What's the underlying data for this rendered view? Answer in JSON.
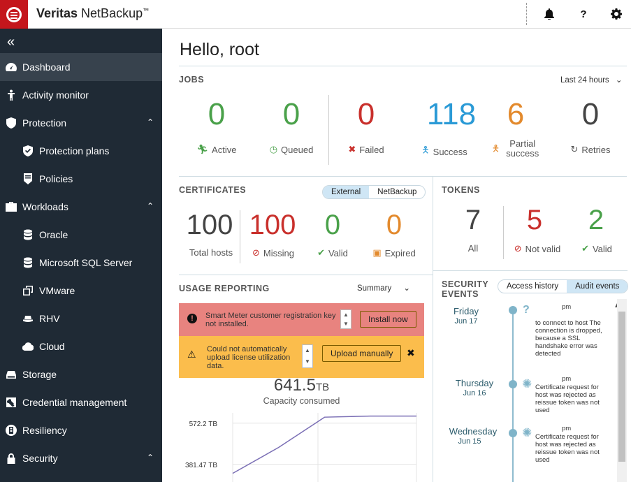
{
  "header": {
    "brand_bold": "Veritas",
    "brand_light": " NetBackup",
    "brand_tm": "™",
    "icons": [
      "bell-icon",
      "help-icon",
      "gear-icon"
    ],
    "help_label": "?",
    "brand_color": "#c4161c"
  },
  "sidebar": {
    "collapse_label": "«",
    "items": [
      {
        "label": "Dashboard",
        "icon": "gauge-icon",
        "active": true
      },
      {
        "label": "Activity monitor",
        "icon": "person-icon"
      },
      {
        "label": "Protection",
        "icon": "shield-icon",
        "expanded": true
      },
      {
        "label": "Protection plans",
        "icon": "shield-check-icon",
        "sub": true
      },
      {
        "label": "Policies",
        "icon": "policy-icon",
        "sub": true
      },
      {
        "label": "Workloads",
        "icon": "briefcase-icon",
        "expanded": true
      },
      {
        "label": "Oracle",
        "icon": "database-icon",
        "sub": true
      },
      {
        "label": "Microsoft SQL Server",
        "icon": "database-icon",
        "sub": true
      },
      {
        "label": "VMware",
        "icon": "vm-icon",
        "sub": true
      },
      {
        "label": "RHV",
        "icon": "hat-icon",
        "sub": true
      },
      {
        "label": "Cloud",
        "icon": "cloud-icon",
        "sub": true
      },
      {
        "label": "Storage",
        "icon": "storage-icon"
      },
      {
        "label": "Credential management",
        "icon": "key-icon"
      },
      {
        "label": "Resiliency",
        "icon": "building-icon"
      },
      {
        "label": "Security",
        "icon": "lock-icon",
        "expanded": true
      }
    ],
    "chevron": "⌃"
  },
  "main": {
    "greeting": "Hello, root",
    "jobs": {
      "title": "JOBS",
      "range": "Last 24 hours",
      "stats": [
        {
          "value": "0",
          "label": "Active",
          "color": "#4aa14a"
        },
        {
          "value": "0",
          "label": "Queued",
          "color": "#4aa14a"
        },
        {
          "value": "0",
          "label": "Failed",
          "color": "#c9302c"
        },
        {
          "value": "118",
          "label": "Success",
          "color": "#2a9ad6"
        },
        {
          "value": "6",
          "label": "Partial success",
          "color": "#e38a2d"
        },
        {
          "value": "0",
          "label": "Retries",
          "color": "#444444"
        }
      ]
    },
    "certificates": {
      "title": "CERTIFICATES",
      "toggle": [
        "External",
        "NetBackup"
      ],
      "stats": [
        {
          "value": "100",
          "label": "Total hosts"
        },
        {
          "value": "100",
          "label": "Missing"
        },
        {
          "value": "0",
          "label": "Valid"
        },
        {
          "value": "0",
          "label": "Expired"
        }
      ]
    },
    "tokens": {
      "title": "TOKENS",
      "stats": [
        {
          "value": "7",
          "label": "All"
        },
        {
          "value": "5",
          "label": "Not valid"
        },
        {
          "value": "2",
          "label": "Valid"
        }
      ]
    },
    "usage": {
      "title": "USAGE REPORTING",
      "view": "Summary",
      "alert1": "Smart Meter customer registration key not installed.",
      "alert1_button": "Install now",
      "alert2": "Could not automatically upload license utilization data.",
      "alert2_button": "Upload manually",
      "close": "✖",
      "capacity_value": "641.5",
      "capacity_unit": "TB",
      "capacity_label": "Capacity consumed",
      "y_ticks": [
        "572.2 TB",
        "381.47 TB"
      ]
    },
    "security_events": {
      "title_line1": "SECURITY",
      "title_line2": "EVENTS",
      "toggle": [
        "Access history",
        "Audit events"
      ],
      "events": [
        {
          "day": "Friday",
          "date": "Jun 17",
          "time": "pm",
          "icon": "question-icon",
          "text": "to connect to host  The connection is dropped, because a SSL handshake error was detected"
        },
        {
          "day": "Thursday",
          "date": "Jun 16",
          "time": "pm",
          "icon": "cert-icon",
          "text": "Certificate request for host  was rejected as reissue token was not used"
        },
        {
          "day": "Wednesday",
          "date": "Jun 15",
          "time": "pm",
          "icon": "cert-icon",
          "text": "Certificate request for host  was rejected as reissue token was not used"
        }
      ]
    }
  },
  "chart_data": {
    "type": "line",
    "title": "",
    "xlabel": "",
    "ylabel": "",
    "y_ticks": [
      "572.2 TB",
      "381.47 TB"
    ],
    "y_tick_values": [
      572.2,
      381.47
    ],
    "ylim": [
      300,
      620
    ],
    "series": [
      {
        "x": [
          0,
          1,
          2,
          3,
          4
        ],
        "values": [
          340,
          460,
          600,
          605,
          605
        ]
      }
    ]
  }
}
